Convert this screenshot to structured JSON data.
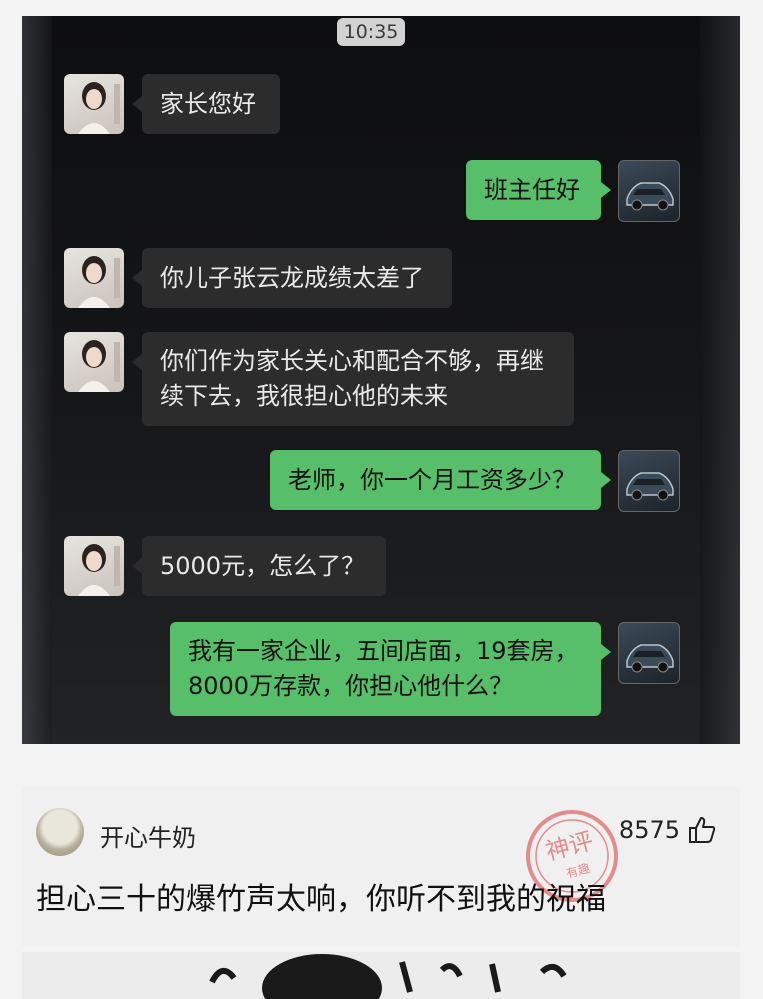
{
  "status_bar": {
    "time": "10:35"
  },
  "messages": [
    {
      "side": "left",
      "text": "家长您好"
    },
    {
      "side": "right",
      "text": "班主任好"
    },
    {
      "side": "left",
      "text": "你儿子张云龙成绩太差了"
    },
    {
      "side": "left",
      "text": "你们作为家长关心和配合不够，再继\n续下去，我很担心他的未来"
    },
    {
      "side": "right",
      "text": "老师，你一个月工资多少？"
    },
    {
      "side": "left",
      "text": "5000元，怎么了？"
    },
    {
      "side": "right",
      "text": "我有一家企业，五间店面，19套房，\n8000万存款，你担心他什么？"
    }
  ],
  "comment": {
    "username": "开心牛奶",
    "likes": "8575",
    "text": "担心三十的爆竹声太响，你听不到我的祝福",
    "stamp_text": "神评",
    "stamp_subtext": "有趣",
    "like_icon": "thumbs-up-icon"
  },
  "colors": {
    "chat_bg": "#141517",
    "bubble_left": "#2c2c2c",
    "bubble_right": "#57be6a",
    "stamp": "#e06a6a"
  }
}
